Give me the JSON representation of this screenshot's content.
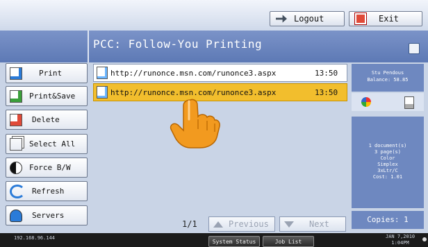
{
  "top": {
    "logout_label": "Logout",
    "exit_label": "Exit"
  },
  "title": "PCC: Follow-You Printing",
  "left_buttons": [
    {
      "label": "Print",
      "icon": "print-doc-icon"
    },
    {
      "label": "Print&Save",
      "icon": "print-save-icon"
    },
    {
      "label": "Delete",
      "icon": "delete-icon"
    },
    {
      "label": "Select All",
      "icon": "select-all-icon"
    },
    {
      "label": "Force B/W",
      "icon": "contrast-icon"
    },
    {
      "label": "Refresh",
      "icon": "refresh-icon"
    },
    {
      "label": "Servers",
      "icon": "servers-icon"
    }
  ],
  "jobs": [
    {
      "url": "http://runonce.msn.com/runonce3.aspx",
      "time": "13:50",
      "selected": false
    },
    {
      "url": "http://runonce.msn.com/runonce3.aspx",
      "time": "13:50",
      "selected": true
    }
  ],
  "pager": {
    "page": "1/1",
    "prev_label": "Previous",
    "next_label": "Next"
  },
  "user": {
    "name": "Stu Pendous",
    "balance": "Balance: 58.85"
  },
  "job_info": [
    "1 document(s)",
    "3 page(s)",
    "Color",
    "Simplex",
    "3xLtr/C",
    "Cost: 1.01"
  ],
  "copies_label": "Copies: 1",
  "status": {
    "ip": "192.168.96.144",
    "system_status_label": "System Status",
    "job_list_label": "Job List",
    "date": "JAN   7,2010",
    "time": "1:04PM"
  },
  "colors": {
    "title_bar": "#5d79b5",
    "selected_row": "#f2be2d",
    "info_panel": "#6e88c0",
    "status_bar": "#1b1b1b"
  }
}
